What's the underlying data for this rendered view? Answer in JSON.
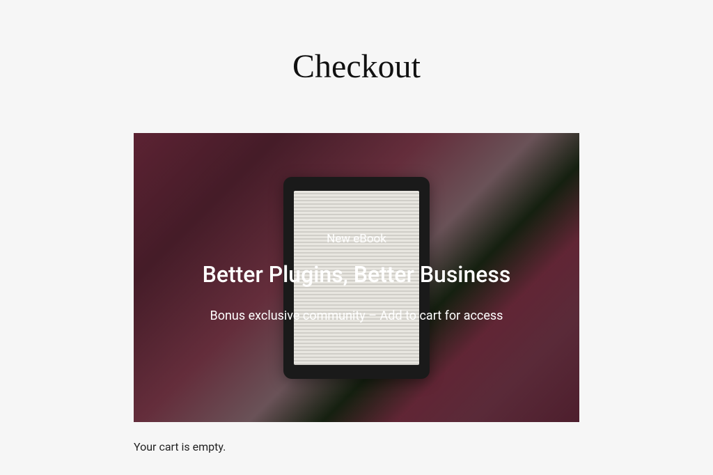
{
  "page": {
    "title": "Checkout"
  },
  "banner": {
    "eyebrow": "New eBook",
    "headline": "Better Plugins, Better Business",
    "subtext": "Bonus exclusive community – Add to cart for access"
  },
  "cart": {
    "empty_message": "Your cart is empty."
  }
}
